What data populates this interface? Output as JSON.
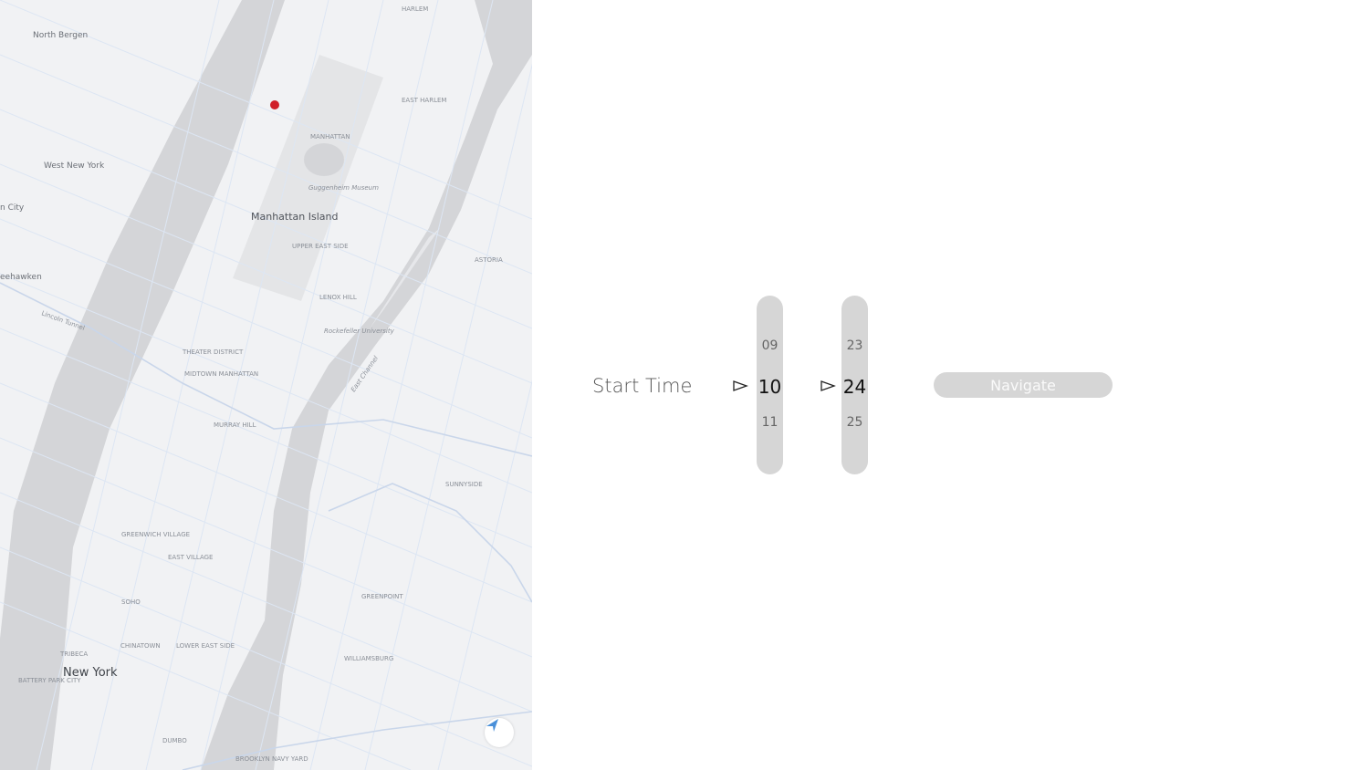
{
  "map": {
    "labels": {
      "north_bergen": "North Bergen",
      "west_new_york": "West New York",
      "union_city": "n City",
      "weehawken": "eehawken",
      "manhattan_island": "Manhattan Island",
      "manhattan": "MANHATTAN",
      "guggenheim": "Guggenheim Museum",
      "upper_east_side": "UPPER EAST SIDE",
      "lenox_hill": "LENOX HILL",
      "rockefeller": "Rockefeller University",
      "theater_district": "THEATER DISTRICT",
      "midtown": "MIDTOWN MANHATTAN",
      "murray_hill": "MURRAY HILL",
      "greenwich_village": "GREENWICH VILLAGE",
      "east_village": "EAST VILLAGE",
      "soho": "SOHO",
      "chinatown": "CHINATOWN",
      "lower_east_side": "LOWER EAST SIDE",
      "tribeca": "TRIBECA",
      "new_york": "New York",
      "greenpoint": "GREENPOINT",
      "williamsburg": "WILLIAMSBURG",
      "sunnyside": "SUNNYSIDE",
      "astoria": "ASTORIA",
      "harlem": "HARLEM",
      "east_harlem": "EAST HARLEM",
      "east_channel": "East Channel",
      "lincoln_tunnel": "Lincoln Tunnel",
      "dumbo": "DUMBO",
      "brooklyn_navy_yard": "BROOKLYN NAVY YARD",
      "battery_park_city": "BATTERY PARK CITY"
    },
    "marker_color": "#d0202a",
    "locate_icon": "location-arrow-icon",
    "locate_color": "#4a90d9"
  },
  "form": {
    "start_time_label": "Start Time",
    "hour_picker": {
      "prev": "09",
      "selected": "10",
      "next": "11"
    },
    "minute_picker": {
      "prev": "23",
      "selected": "24",
      "next": "25"
    },
    "navigate_label": "Navigate"
  }
}
